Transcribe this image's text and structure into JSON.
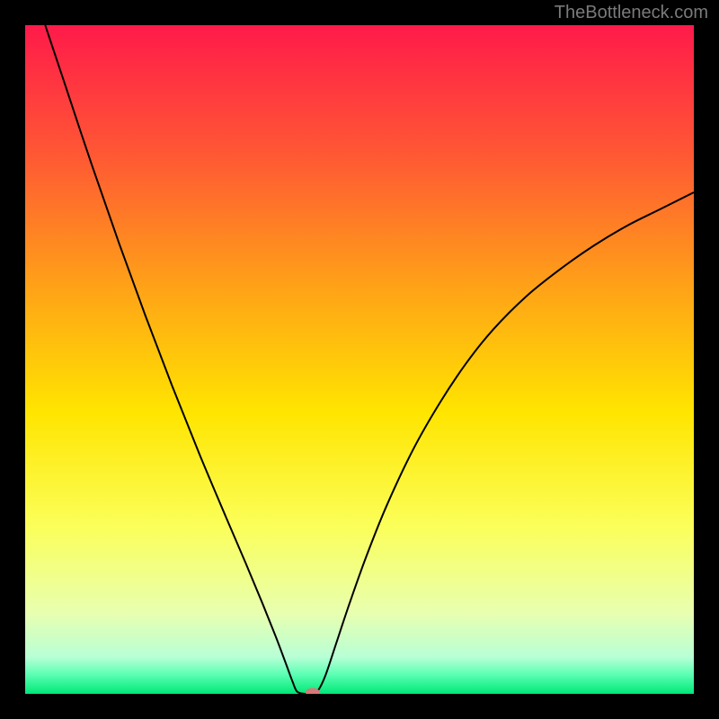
{
  "watermark": "TheBottleneck.com",
  "chart_data": {
    "type": "line",
    "title": "",
    "xlabel": "",
    "ylabel": "",
    "xlim": [
      0,
      100
    ],
    "ylim": [
      0,
      100
    ],
    "background": {
      "type": "vertical-gradient",
      "stops": [
        {
          "offset": 0.0,
          "color": "#ff1a4a"
        },
        {
          "offset": 0.2,
          "color": "#ff5a33"
        },
        {
          "offset": 0.4,
          "color": "#ffa516"
        },
        {
          "offset": 0.58,
          "color": "#ffe500"
        },
        {
          "offset": 0.75,
          "color": "#fbff5a"
        },
        {
          "offset": 0.88,
          "color": "#e8ffb0"
        },
        {
          "offset": 0.945,
          "color": "#b8ffd6"
        },
        {
          "offset": 0.97,
          "color": "#5fffb5"
        },
        {
          "offset": 1.0,
          "color": "#00e878"
        }
      ]
    },
    "series": [
      {
        "name": "bottleneck-curve",
        "type": "line",
        "color": "#000000",
        "width": 2,
        "points": [
          {
            "x": 3.0,
            "y": 100.0
          },
          {
            "x": 6.0,
            "y": 91.0
          },
          {
            "x": 10.0,
            "y": 79.0
          },
          {
            "x": 14.0,
            "y": 67.5
          },
          {
            "x": 18.0,
            "y": 56.5
          },
          {
            "x": 22.0,
            "y": 46.0
          },
          {
            "x": 26.0,
            "y": 36.0
          },
          {
            "x": 30.0,
            "y": 26.5
          },
          {
            "x": 33.0,
            "y": 19.5
          },
          {
            "x": 35.5,
            "y": 13.5
          },
          {
            "x": 37.5,
            "y": 8.5
          },
          {
            "x": 39.0,
            "y": 4.5
          },
          {
            "x": 40.0,
            "y": 1.8
          },
          {
            "x": 40.7,
            "y": 0.3
          },
          {
            "x": 42.0,
            "y": 0.0
          },
          {
            "x": 43.2,
            "y": 0.0
          },
          {
            "x": 44.0,
            "y": 0.8
          },
          {
            "x": 45.0,
            "y": 3.0
          },
          {
            "x": 46.5,
            "y": 7.5
          },
          {
            "x": 48.5,
            "y": 13.5
          },
          {
            "x": 51.0,
            "y": 20.5
          },
          {
            "x": 54.0,
            "y": 28.0
          },
          {
            "x": 58.0,
            "y": 36.5
          },
          {
            "x": 62.0,
            "y": 43.5
          },
          {
            "x": 66.0,
            "y": 49.5
          },
          {
            "x": 70.0,
            "y": 54.5
          },
          {
            "x": 75.0,
            "y": 59.5
          },
          {
            "x": 80.0,
            "y": 63.5
          },
          {
            "x": 85.0,
            "y": 67.0
          },
          {
            "x": 90.0,
            "y": 70.0
          },
          {
            "x": 95.0,
            "y": 72.5
          },
          {
            "x": 100.0,
            "y": 75.0
          }
        ]
      }
    ],
    "marker": {
      "x": 43.0,
      "y": 0.2,
      "rx": 8,
      "ry": 5,
      "color": "#d87878"
    }
  }
}
